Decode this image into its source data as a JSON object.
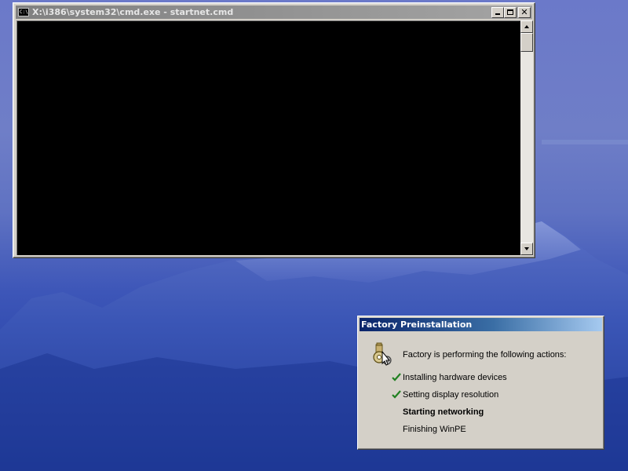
{
  "cmd_window": {
    "title": "X:\\i386\\system32\\cmd.exe - startnet.cmd",
    "icon_text": "C:\\",
    "buttons": {
      "minimize": "minimize",
      "maximize": "maximize",
      "close": "✕"
    }
  },
  "factory_dialog": {
    "title": "Factory Preinstallation",
    "heading": "Factory is performing the following actions:",
    "steps": [
      {
        "label": "Installing hardware devices",
        "status": "done"
      },
      {
        "label": "Setting display resolution",
        "status": "done"
      },
      {
        "label": "Starting networking",
        "status": "current"
      },
      {
        "label": "Finishing WinPE",
        "status": "pending"
      }
    ]
  },
  "colors": {
    "accent_title": "#0a246a",
    "check_green": "#208020",
    "console_bg": "#000000"
  },
  "icons": {
    "console": "console-icon",
    "factory": "factory-gears-icon",
    "check": "checkmark-icon"
  }
}
